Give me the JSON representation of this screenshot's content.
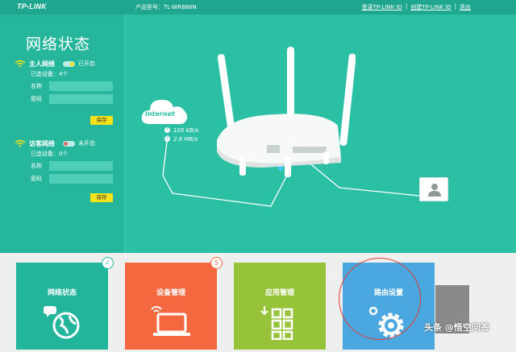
{
  "topbar": {
    "logo": "TP-LINK",
    "model": "产品型号：TL-WR886N",
    "login_link": "登录TP-LINK ID",
    "separator": "|",
    "create_link": "创建TP-LINK ID",
    "separator2": "|",
    "exit_link": "退出"
  },
  "left_panel": {
    "title": "网络状态",
    "host_network": {
      "name": "主人网络",
      "status": "已开启",
      "connected": "已连设备：4个",
      "name_label": "名称",
      "password_label": "密码",
      "save": "保存"
    },
    "guest_network": {
      "name": "访客网络",
      "status": "未开启",
      "connected": "已连设备：0个",
      "name_label": "名称",
      "password_label": "密码",
      "save": "保存"
    }
  },
  "scene": {
    "cloud_label": "Internet",
    "upload_speed": "105 KB/s",
    "download_speed": "2.6 MB/s"
  },
  "tiles": [
    {
      "label": "网络状态",
      "color": "#21b69b",
      "icon": "globe-chat-icon",
      "badge": "✓"
    },
    {
      "label": "设备管理",
      "color": "#f4683f",
      "icon": "laptop-wifi-icon",
      "badge": "5"
    },
    {
      "label": "应用管理",
      "color": "#97c33b",
      "icon": "apps-grid-icon"
    },
    {
      "label": "路由设置",
      "color": "#4aa7e0",
      "icon": "gear-icon"
    }
  ],
  "watermark": "头条 @悟空问答",
  "colors": {
    "accent": "#2bbfa4",
    "save_button": "#f6e21a",
    "annotation_circle": "#e23c2f"
  }
}
